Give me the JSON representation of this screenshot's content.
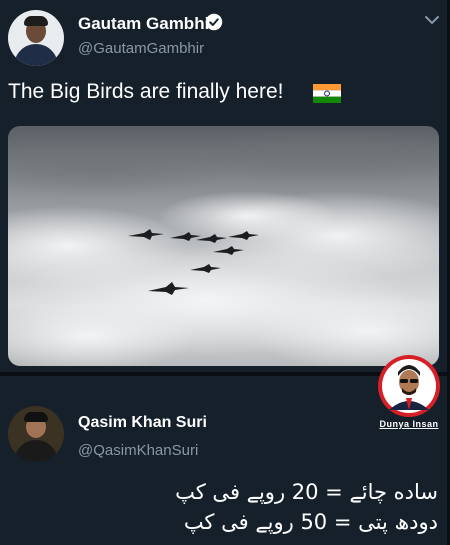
{
  "tweet1": {
    "author_name": "Gautam Gambhir",
    "handle": "@GautamGambhir",
    "text": "The Big Birds are finally here!",
    "icons": [
      "verified-badge-icon",
      "chevron-down-icon",
      "india-flag-emoji"
    ],
    "colors": {
      "verified": "#1da1f2",
      "handle": "#8899a6"
    }
  },
  "tweet2": {
    "author_name": "Qasim Khan Suri",
    "handle": "@QasimKhanSuri",
    "line1": "ساده چائے = 20 روپے فی کپ",
    "line2": "دودھ پتی = 50 روپے فی کپ"
  },
  "watermark": {
    "text": "Dunya Insan"
  },
  "theme": {
    "background": "#15202b",
    "text": "#ffffff",
    "muted": "#8899a6"
  }
}
